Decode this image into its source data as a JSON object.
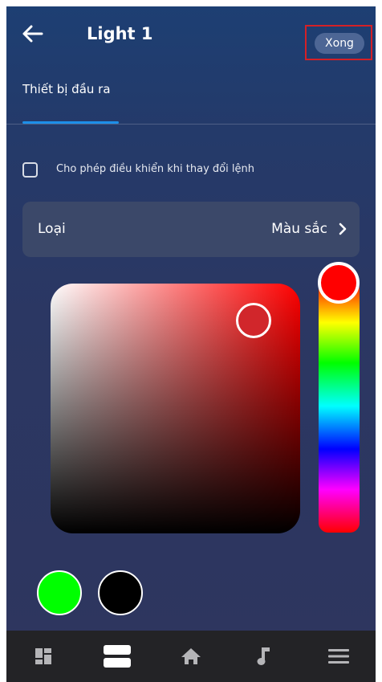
{
  "header": {
    "title": "Light 1",
    "back_icon": "arrow-left-icon",
    "done_label": "Xong"
  },
  "tabs": [
    {
      "label": "Thiết bị đầu ra",
      "active": true
    }
  ],
  "options": {
    "allow_control_label": "Cho phép điều khiển khi thay đổi lệnh",
    "allow_control_checked": false
  },
  "type_row": {
    "label": "Loại",
    "value": "Màu sắc",
    "icon": "chevron-right-icon"
  },
  "color_picker": {
    "selected_color": "#ff0000",
    "hue_color": "#ff0000"
  },
  "swatches": [
    {
      "color": "#00ff00"
    },
    {
      "color": "#000000"
    }
  ],
  "bottom_nav": [
    {
      "icon": "dashboard-icon",
      "active": false
    },
    {
      "icon": "devices-icon",
      "active": true
    },
    {
      "icon": "home-icon",
      "active": false
    },
    {
      "icon": "music-icon",
      "active": false
    },
    {
      "icon": "menu-icon",
      "active": false
    }
  ],
  "colors": {
    "accent": "#1d8fe8",
    "highlight_box": "#d42026",
    "nav_inactive": "#b5b5b8",
    "nav_active": "#ffffff"
  }
}
